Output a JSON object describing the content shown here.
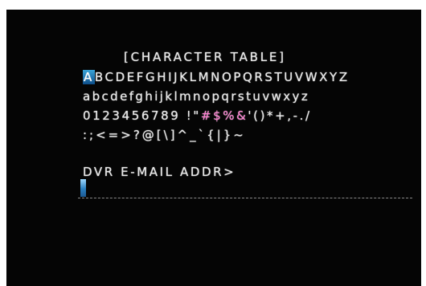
{
  "screen": {
    "title": "[CHARACTER TABLE]",
    "rows": {
      "upper_rest": "BCDEFGHIJKLMNOPQRSTUVWXYZ",
      "lower": "abcdefghijklmnopqrstuvwxyz",
      "digits_a": "0123456789 !\"",
      "digits_hi": "#$%&",
      "digits_b": "'()*+,-./",
      "symbols": ":;<=>?@[\\]^_`{|}~"
    },
    "selected_char": "A",
    "field_label": "DVR E-MAIL ADDR>",
    "field_value": "",
    "colors": {
      "background": "#050505",
      "text": "#e8e8e8",
      "highlight": "#2a8cc8",
      "accent_chars": "#ff7ad0"
    }
  }
}
